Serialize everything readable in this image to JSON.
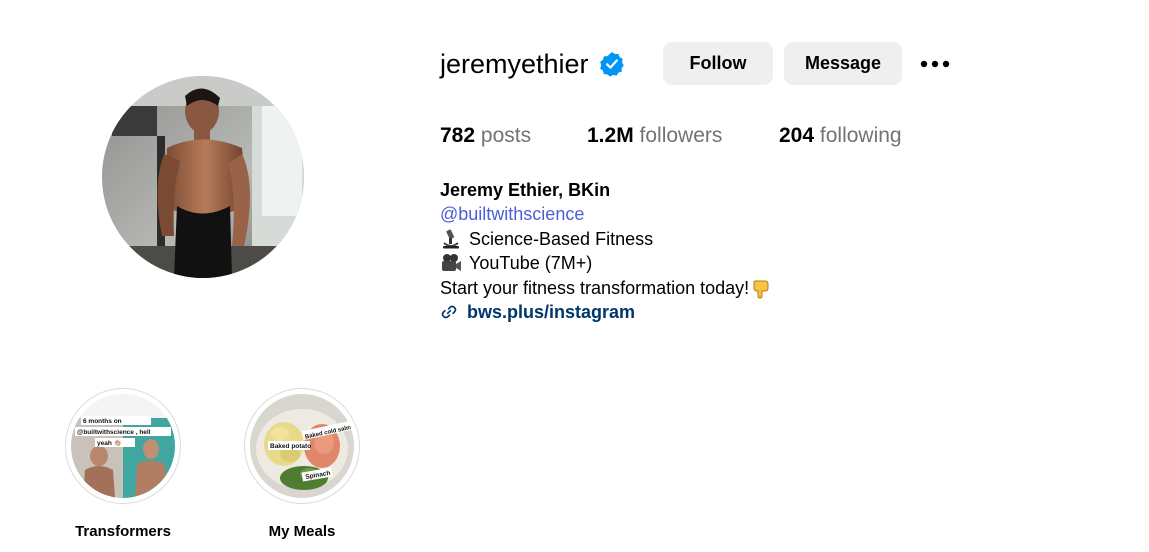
{
  "profile": {
    "username": "jeremyethier",
    "verified_icon": "verified-badge-icon",
    "buttons": {
      "follow": "Follow",
      "message": "Message"
    },
    "more_icon": "more-options-icon"
  },
  "stats": {
    "posts": {
      "count": "782",
      "label": "posts"
    },
    "followers": {
      "count": "1.2M",
      "label": "followers"
    },
    "following": {
      "count": "204",
      "label": "following"
    }
  },
  "bio": {
    "name": "Jeremy Ethier, BKin",
    "handle": "@builtwithscience",
    "lines": [
      {
        "icon": "microscope-emoji",
        "text": "Science-Based Fitness"
      },
      {
        "icon": "movie-camera-emoji",
        "text": "YouTube (7M+)"
      },
      {
        "text": "Start your fitness transformation today!",
        "icon_after": "pointing-down-emoji"
      }
    ],
    "link": {
      "icon": "link-icon",
      "text": "bws.plus/instagram"
    }
  },
  "highlights": [
    {
      "label": "Transformers",
      "cover_text": [
        "6 months on",
        "@builtwithscience , hell",
        "yeah 👏🏼"
      ]
    },
    {
      "label": "My Meals",
      "cover_text": [
        "Baked potato",
        "Baked cold salmon",
        "Spinach"
      ]
    }
  ],
  "colors": {
    "background": "#ffffff",
    "button_bg": "#efefef",
    "secondary_text": "#737373",
    "mention": "#4a5fd9",
    "link": "#00376b",
    "verified": "#0095f6"
  }
}
